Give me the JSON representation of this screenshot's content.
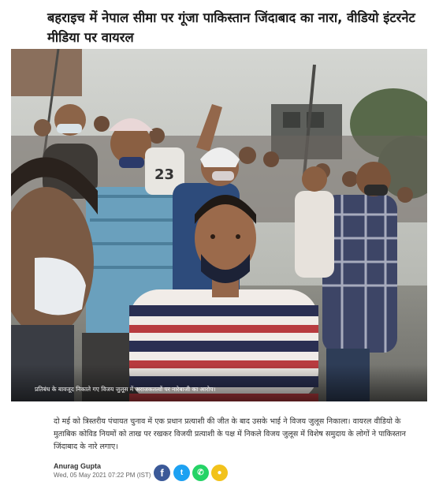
{
  "article": {
    "headline": "बहराइच में नेपाल सीमा पर गूंजा पाकिस्तान जिंदाबाद का नारा, वीडियो इंटरनेट मीडिया पर वायरल",
    "image_caption": "प्रतिबंध के बावजूद निकाले गए विजय जुलूस में अराजकतत्वों पर नारेबाजी का आरोप।",
    "summary": "दो मई को त्रिस्तरीय पंचायत चुनाव में एक प्रधान प्रत्याशी की जीत के बाद उसके भाई ने विजय जुलूस निकाला। वायरल वीडियो के मुताबिक कोविड नियमों को ताख पर रखकर विजयी प्रत्याशी के पक्ष में निकले विजय जुलूस में विशेष समुदाय के लोगों ने पाकिस्तान जिंदाबाद के नारे लगाए।",
    "author": "Anurag Gupta",
    "published": "Wed, 05 May 2021 07:22 PM (IST)"
  },
  "photo": {
    "jersey_number": "23"
  },
  "share": {
    "facebook_glyph": "f",
    "twitter_glyph": "t",
    "whatsapp_glyph": "✆",
    "koo_glyph": "●"
  },
  "colors": {
    "facebook": "#3b5998",
    "twitter": "#1da1f2",
    "whatsapp": "#25d366",
    "koo": "#f2c21b"
  }
}
